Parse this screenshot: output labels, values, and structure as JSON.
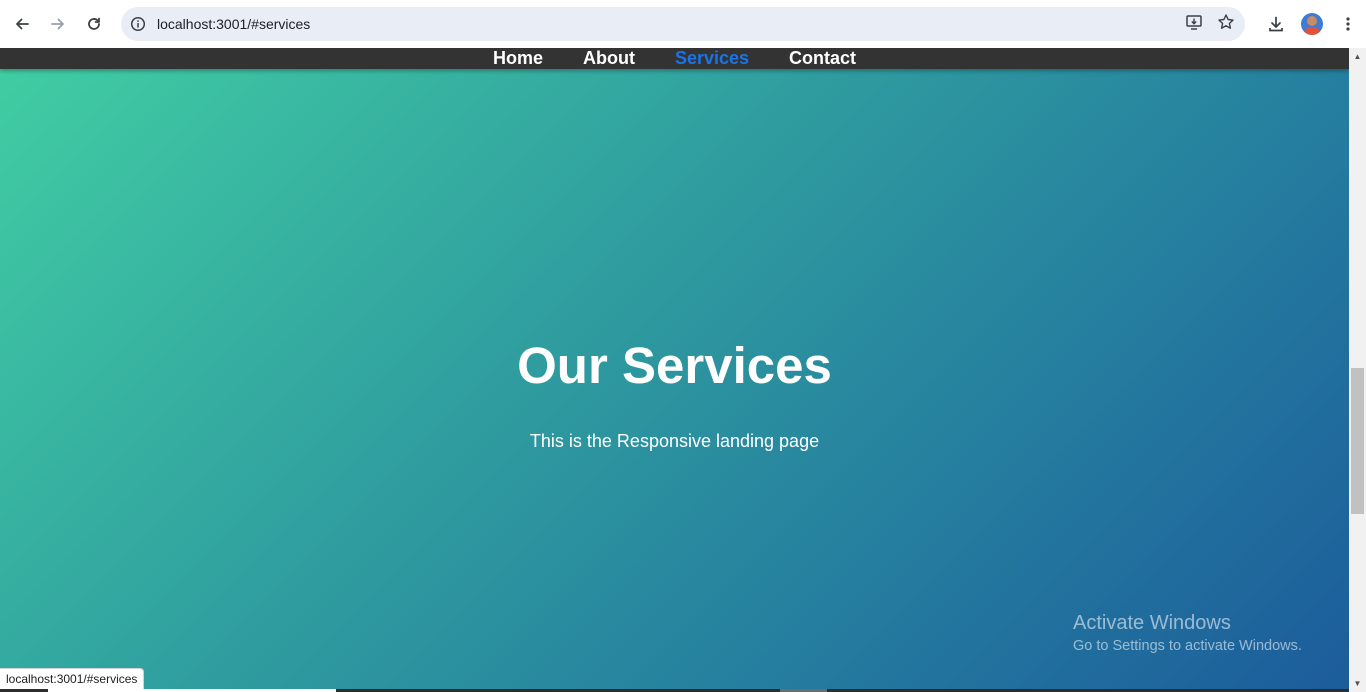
{
  "browser": {
    "url": "localhost:3001/#services",
    "status_url": "localhost:3001/#services"
  },
  "nav": {
    "items": [
      {
        "label": "Home",
        "active": false
      },
      {
        "label": "About",
        "active": false
      },
      {
        "label": "Services",
        "active": true
      },
      {
        "label": "Contact",
        "active": false
      }
    ],
    "active_color": "#1a73e8",
    "bar_color": "#333333"
  },
  "hero": {
    "title": "Our Services",
    "subtitle": "This is the Responsive landing page",
    "gradient_colors": [
      "#41cea3",
      "#1c5c9b"
    ]
  },
  "watermark": {
    "line1": "Activate Windows",
    "line2": "Go to Settings to activate Windows."
  },
  "icons": {
    "back": "arrow-left-icon",
    "forward": "arrow-right-icon",
    "reload": "reload-icon",
    "site_info": "info-icon",
    "install": "install-app-icon",
    "bookmark": "star-icon",
    "download": "download-icon",
    "profile": "avatar",
    "menu": "kebab-menu-icon"
  }
}
